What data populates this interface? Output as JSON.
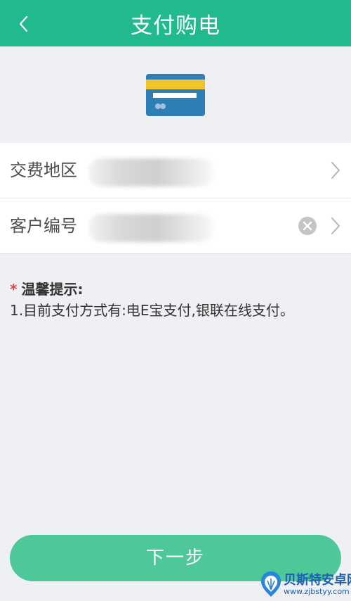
{
  "header": {
    "title": "支付购电",
    "back_icon": "chevron-left-icon"
  },
  "banner": {
    "icon": "credit-card-icon"
  },
  "form": {
    "region": {
      "label": "交费地区",
      "value": ""
    },
    "customer_no": {
      "label": "客户编号",
      "value": ""
    }
  },
  "notice": {
    "star": "*",
    "title": "温馨提示:",
    "lines": [
      "1.目前支付方式有:电E宝支付,银联在线支付。"
    ]
  },
  "actions": {
    "next_label": "下一步"
  },
  "watermark": {
    "name": "贝斯特安卓网",
    "url": "www.zjbstyy.com"
  },
  "colors": {
    "header_bg": "#21b98e",
    "button_bg": "#4ec898",
    "page_bg": "#eef0f3",
    "required_star": "#e0474b"
  }
}
